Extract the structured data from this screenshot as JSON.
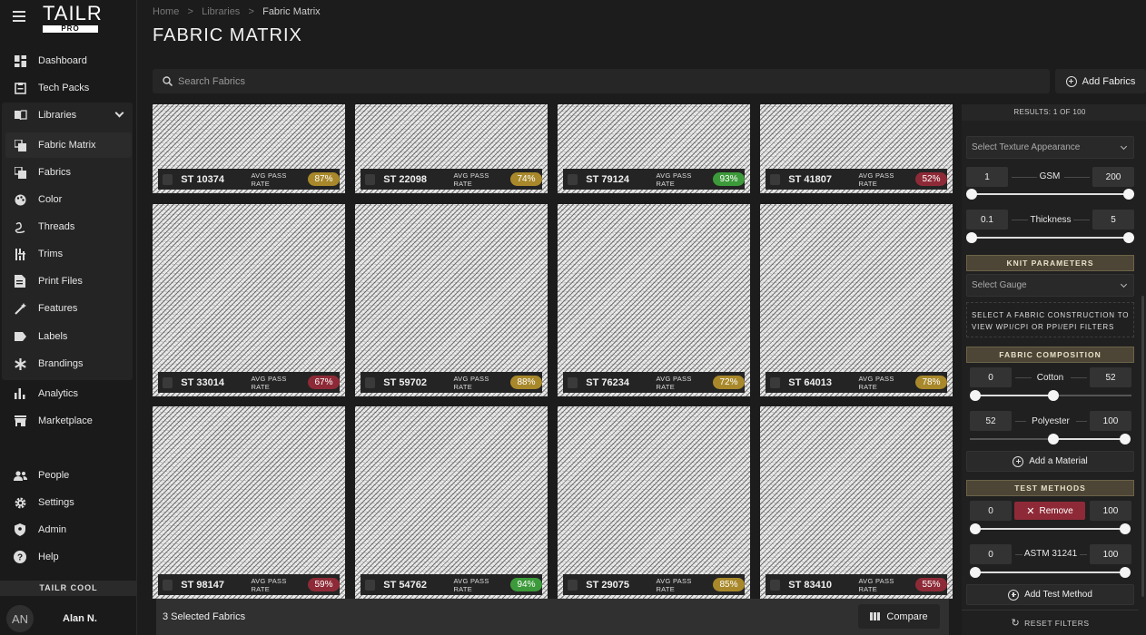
{
  "app": {
    "logo": "TAILR",
    "logo_badge": "PRO"
  },
  "sidebar": {
    "items": [
      {
        "label": "Dashboard",
        "icon": "dashboard-icon"
      },
      {
        "label": "Tech Packs",
        "icon": "techpack-icon"
      },
      {
        "label": "Libraries",
        "icon": "library-icon"
      },
      {
        "label": "Fabric Matrix",
        "icon": "fabric-matrix-icon"
      },
      {
        "label": "Fabrics",
        "icon": "fabrics-icon"
      },
      {
        "label": "Color",
        "icon": "palette-icon"
      },
      {
        "label": "Threads",
        "icon": "threads-icon"
      },
      {
        "label": "Trims",
        "icon": "trims-icon"
      },
      {
        "label": "Print Files",
        "icon": "print-files-icon"
      },
      {
        "label": "Features",
        "icon": "features-icon"
      },
      {
        "label": "Labels",
        "icon": "label-icon"
      },
      {
        "label": "Brandings",
        "icon": "branding-icon"
      },
      {
        "label": "Analytics",
        "icon": "analytics-icon"
      },
      {
        "label": "Marketplace",
        "icon": "marketplace-icon"
      },
      {
        "label": "People",
        "icon": "people-icon"
      },
      {
        "label": "Settings",
        "icon": "gear-icon"
      },
      {
        "label": "Admin",
        "icon": "shield-icon"
      },
      {
        "label": "Help",
        "icon": "help-icon"
      }
    ],
    "workspace": "TAILR COOL",
    "user": {
      "initials": "AN",
      "name": "Alan N."
    }
  },
  "breadcrumb": {
    "home": "Home",
    "sep": ">",
    "libraries": "Libraries",
    "current": "Fabric Matrix"
  },
  "page_title": "FABRIC MATRIX",
  "search": {
    "placeholder": "Search Fabrics"
  },
  "add_fabrics_label": "Add Fabrics",
  "rate_label": "AVG PASS RATE",
  "fabrics": [
    {
      "code": "ST 10374",
      "rate": "87%",
      "color": "#a8882a"
    },
    {
      "code": "ST 22098",
      "rate": "74%",
      "color": "#a8882a"
    },
    {
      "code": "ST 79124",
      "rate": "93%",
      "color": "#3c9a3a"
    },
    {
      "code": "ST 41807",
      "rate": "52%",
      "color": "#8e2a37"
    },
    {
      "code": "ST 33014",
      "rate": "67%",
      "color": "#8e2a37"
    },
    {
      "code": "ST 59702",
      "rate": "88%",
      "color": "#a8882a"
    },
    {
      "code": "ST 76234",
      "rate": "72%",
      "color": "#a8882a"
    },
    {
      "code": "ST 64013",
      "rate": "78%",
      "color": "#a8882a"
    },
    {
      "code": "ST 98147",
      "rate": "59%",
      "color": "#8e2a37"
    },
    {
      "code": "ST 54762",
      "rate": "94%",
      "color": "#3c9a3a"
    },
    {
      "code": "ST 29075",
      "rate": "85%",
      "color": "#a8882a"
    },
    {
      "code": "ST 83410",
      "rate": "55%",
      "color": "#8e2a37"
    }
  ],
  "selection": {
    "text": "3 Selected Fabrics",
    "compare_label": "Compare"
  },
  "filters": {
    "results": "RESULTS: 1 OF 100",
    "texture_placeholder": "Select Texture Appearance",
    "gsm": {
      "min": "1",
      "label": "GSM",
      "max": "200"
    },
    "thickness": {
      "min": "0.1",
      "label": "Thickness",
      "max": "5"
    },
    "knit_header": "KNIT PARAMETERS",
    "gauge_placeholder": "Select Gauge",
    "info_text": "SELECT A FABRIC CONSTRUCTION TO VIEW WPI/CPI OR PPI/EPI FILTERS",
    "composition_header": "FABRIC COMPOSITION",
    "cotton": {
      "min": "0",
      "label": "Cotton",
      "max": "52"
    },
    "polyester": {
      "min": "52",
      "label": "Polyester",
      "max": "100"
    },
    "add_material": "Add a Material",
    "test_header": "TEST METHODS",
    "test1": {
      "min": "0",
      "remove_label": "Remove",
      "max": "100"
    },
    "test2": {
      "min": "0",
      "label": "ASTM 31241",
      "max": "100"
    },
    "add_test": "Add Test Method",
    "reset": "RESET FILTERS"
  }
}
